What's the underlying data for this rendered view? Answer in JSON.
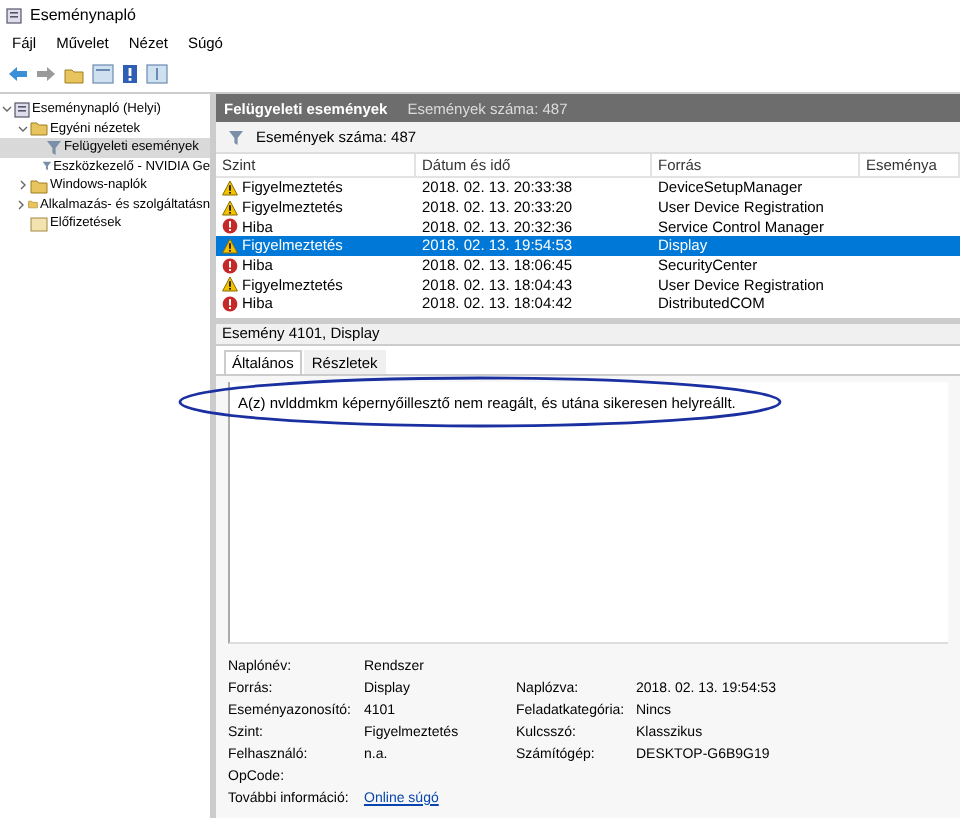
{
  "window": {
    "title": "Eseménynapló"
  },
  "menu": [
    "Fájl",
    "Művelet",
    "Nézet",
    "Súgó"
  ],
  "tree": [
    {
      "label": "Eseménynapló (Helyi)",
      "kind": "log",
      "expanded": true,
      "selected": false,
      "children": [
        {
          "label": "Egyéni nézetek",
          "kind": "folder",
          "expanded": true,
          "selected": false,
          "children": [
            {
              "label": "Felügyeleti események",
              "kind": "filter",
              "selected": true
            },
            {
              "label": "Eszközkezelő - NVIDIA Ge",
              "kind": "filter",
              "selected": false
            }
          ]
        },
        {
          "label": "Windows-naplók",
          "kind": "folder",
          "expanded": false,
          "selected": false
        },
        {
          "label": "Alkalmazás- és szolgáltatásn",
          "kind": "folder",
          "expanded": false,
          "selected": false
        },
        {
          "label": "Előfizetések",
          "kind": "sub",
          "selected": false
        }
      ]
    }
  ],
  "pane": {
    "title": "Felügyeleti események",
    "count": "Események száma: 487",
    "filter_text": "Események száma: 487"
  },
  "table": {
    "columns": [
      "Szint",
      "Dátum és idő",
      "Forrás",
      "Eseménya"
    ],
    "rows": [
      {
        "kind": "warning",
        "level": "Figyelmeztetés",
        "date": "2018. 02. 13. 20:33:38",
        "source": "DeviceSetupManager",
        "selected": false
      },
      {
        "kind": "warning",
        "level": "Figyelmeztetés",
        "date": "2018. 02. 13. 20:33:20",
        "source": "User Device Registration",
        "selected": false
      },
      {
        "kind": "error",
        "level": "Hiba",
        "date": "2018. 02. 13. 20:32:36",
        "source": "Service Control Manager",
        "selected": false
      },
      {
        "kind": "warning",
        "level": "Figyelmeztetés",
        "date": "2018. 02. 13. 19:54:53",
        "source": "Display",
        "selected": true
      },
      {
        "kind": "error",
        "level": "Hiba",
        "date": "2018. 02. 13. 18:06:45",
        "source": "SecurityCenter",
        "selected": false
      },
      {
        "kind": "warning",
        "level": "Figyelmeztetés",
        "date": "2018. 02. 13. 18:04:43",
        "source": "User Device Registration",
        "selected": false
      },
      {
        "kind": "error",
        "level": "Hiba",
        "date": "2018. 02. 13. 18:04:42",
        "source": "DistributedCOM",
        "selected": false
      }
    ]
  },
  "detail": {
    "title": "Esemény 4101, Display",
    "tabs": [
      {
        "label": "Általános",
        "selected": true
      },
      {
        "label": "Részletek",
        "selected": false
      }
    ],
    "message": "A(z) nvlddmkm képernyőillesztő nem reagált, és utána sikeresen helyreállt.",
    "fields": [
      [
        {
          "label": "Naplónév:",
          "value": "Rendszer"
        }
      ],
      [
        {
          "label": "Forrás:",
          "value": "Display"
        },
        {
          "label": "Naplózva:",
          "value": "2018. 02. 13. 19:54:53"
        }
      ],
      [
        {
          "label": "Eseményazonosító:",
          "value": "4101"
        },
        {
          "label": "Feladatkategória:",
          "value": "Nincs"
        }
      ],
      [
        {
          "label": "Szint:",
          "value": "Figyelmeztetés"
        },
        {
          "label": "Kulcsszó:",
          "value": "Klasszikus"
        }
      ],
      [
        {
          "label": "Felhasználó:",
          "value": "n.a."
        },
        {
          "label": "Számítógép:",
          "value": "DESKTOP-G6B9G19"
        }
      ],
      [
        {
          "label": "OpCode:"
        }
      ],
      [
        {
          "label": "További információ:",
          "link": "Online súgó"
        }
      ]
    ]
  }
}
